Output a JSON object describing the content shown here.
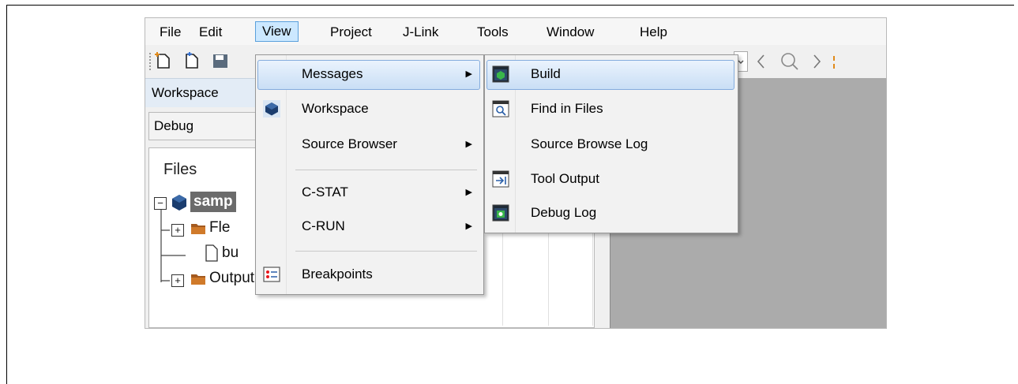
{
  "menubar": {
    "items": [
      {
        "label": "File"
      },
      {
        "label": "Edit"
      },
      {
        "label": "View"
      },
      {
        "label": "Project"
      },
      {
        "label": "J-Link"
      },
      {
        "label": "Tools"
      },
      {
        "label": "Window"
      },
      {
        "label": "Help"
      }
    ],
    "active": "View"
  },
  "workspace": {
    "title": "Workspace",
    "configuration": "Debug",
    "files_header": "Files",
    "tree": [
      {
        "label": "samp",
        "type": "project",
        "expanded": true
      },
      {
        "label": "Fle",
        "type": "folder",
        "expanded": false
      },
      {
        "label": "bu",
        "type": "file"
      },
      {
        "label": "Output",
        "type": "folder",
        "expanded": false
      }
    ]
  },
  "view_menu": {
    "items": [
      {
        "label": "Messages",
        "submenu": true,
        "highlighted": true
      },
      {
        "label": "Workspace",
        "icon": "workspace-icon"
      },
      {
        "label": "Source Browser",
        "submenu": true
      },
      {
        "label": "C-STAT",
        "submenu": true
      },
      {
        "label": "C-RUN",
        "submenu": true
      },
      {
        "label": "Breakpoints",
        "icon": "breakpoints-icon"
      }
    ]
  },
  "messages_submenu": {
    "items": [
      {
        "label": "Build",
        "icon": "build-window-icon",
        "highlighted": true
      },
      {
        "label": "Find in Files",
        "icon": "find-in-files-icon"
      },
      {
        "label": "Source Browse Log"
      },
      {
        "label": "Tool Output",
        "icon": "tool-output-icon"
      },
      {
        "label": "Debug Log",
        "icon": "debug-log-icon"
      }
    ]
  },
  "colors": {
    "menu_highlight": "#c9def5",
    "editor_bg": "#ababab",
    "breakpoint": "#e8161b"
  }
}
